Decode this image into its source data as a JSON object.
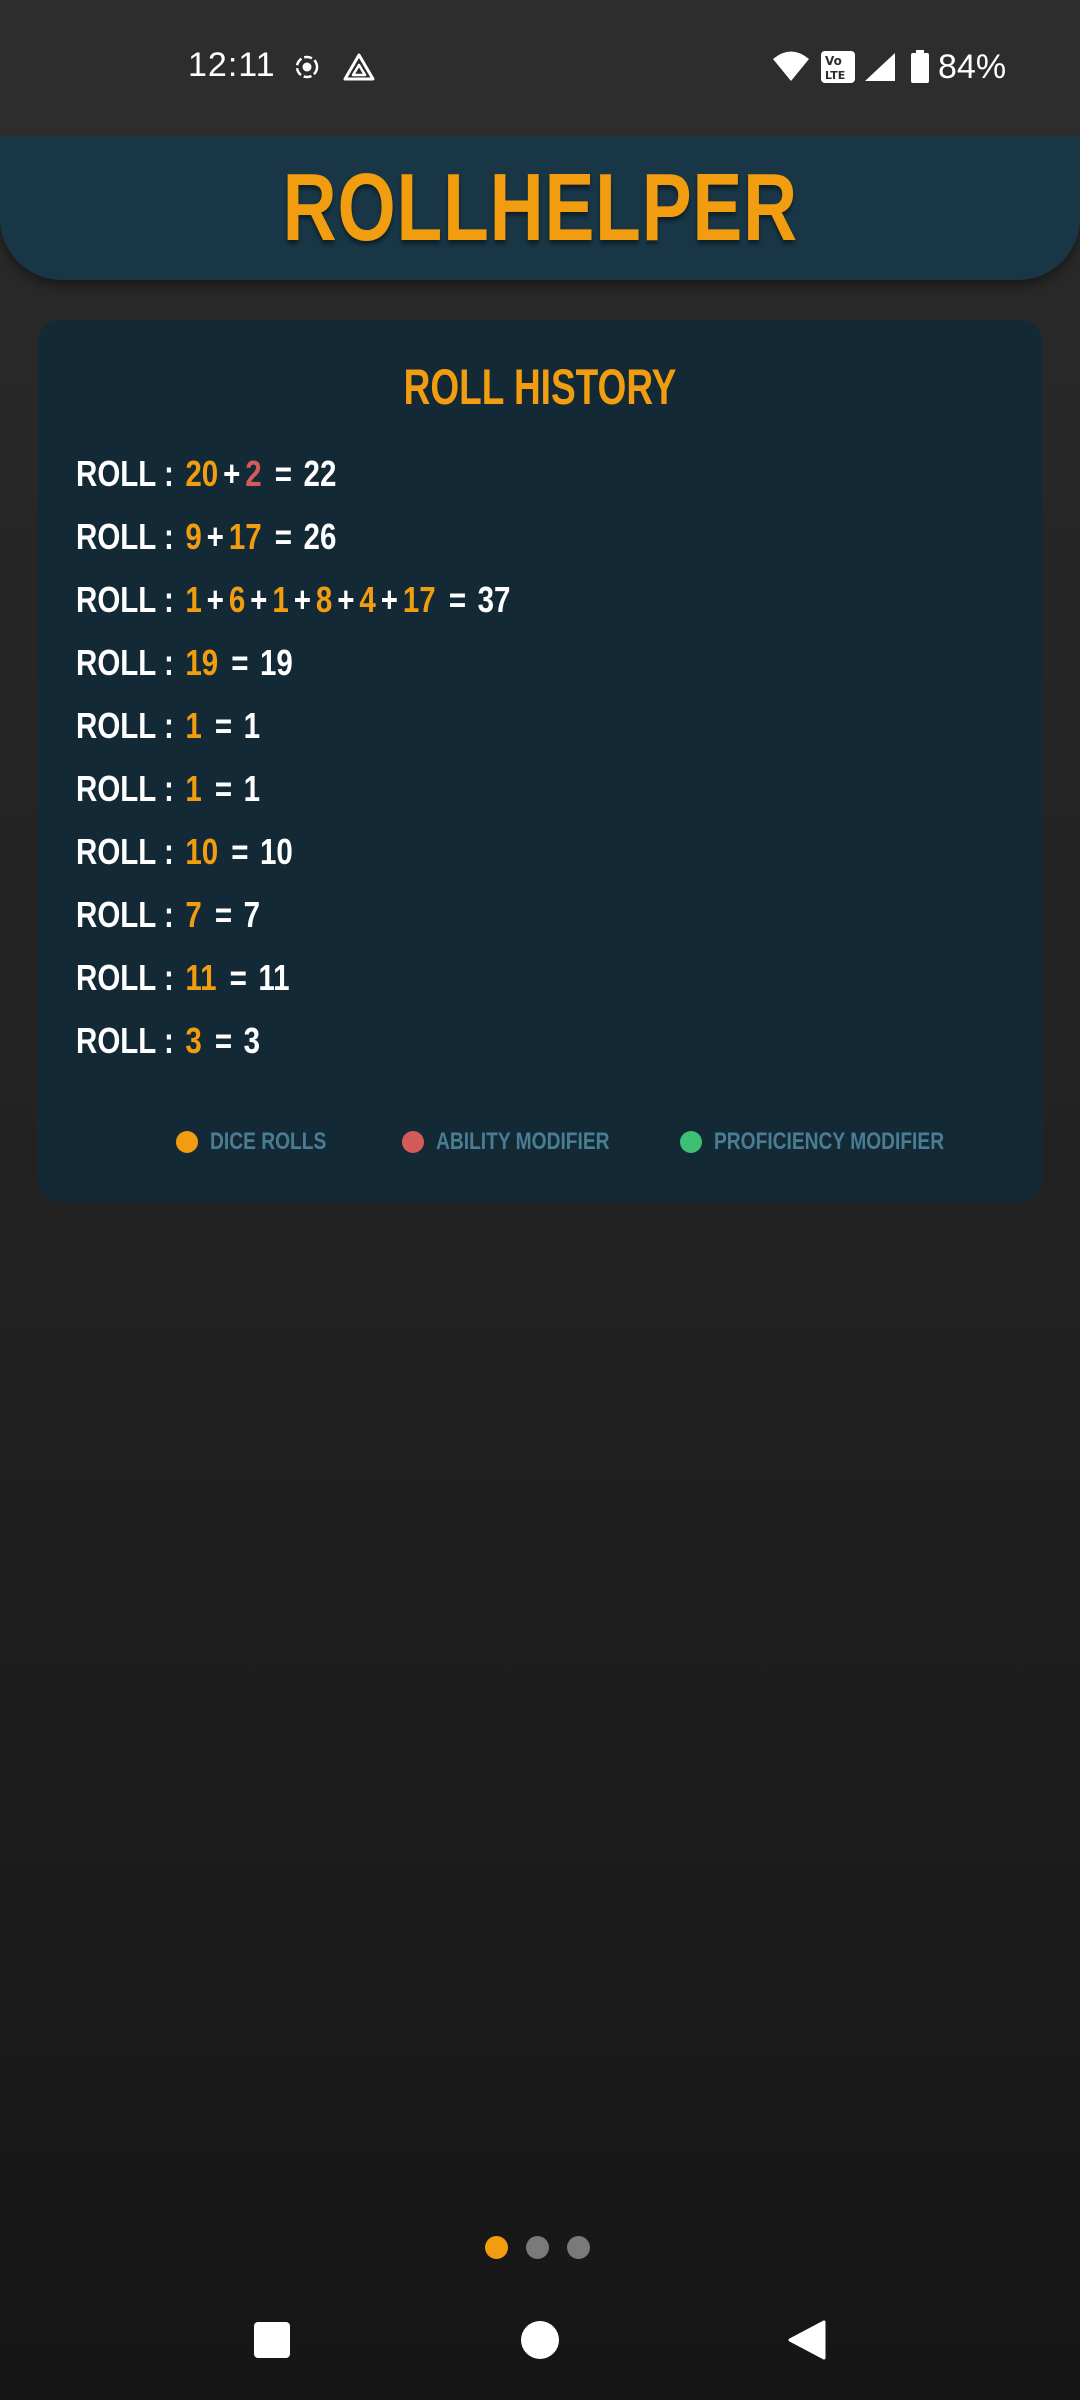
{
  "status_bar": {
    "time": "12:11",
    "battery": "84%",
    "icons": [
      "record-icon",
      "drive-icon",
      "wifi-icon",
      "volte-icon",
      "signal-icon",
      "battery-icon"
    ]
  },
  "header": {
    "title": "ROLLHELPER"
  },
  "roll_history": {
    "title": "ROLL HISTORY",
    "row_label": "ROLL :",
    "rows": [
      {
        "terms": [
          {
            "v": "20",
            "t": "dice"
          },
          {
            "v": "2",
            "t": "ability"
          }
        ],
        "total": "22"
      },
      {
        "terms": [
          {
            "v": "9",
            "t": "dice"
          },
          {
            "v": "17",
            "t": "dice"
          }
        ],
        "total": "26"
      },
      {
        "terms": [
          {
            "v": "1",
            "t": "dice"
          },
          {
            "v": "6",
            "t": "dice"
          },
          {
            "v": "1",
            "t": "dice"
          },
          {
            "v": "8",
            "t": "dice"
          },
          {
            "v": "4",
            "t": "dice"
          },
          {
            "v": "17",
            "t": "dice"
          }
        ],
        "total": "37"
      },
      {
        "terms": [
          {
            "v": "19",
            "t": "dice"
          }
        ],
        "total": "19"
      },
      {
        "terms": [
          {
            "v": "1",
            "t": "dice"
          }
        ],
        "total": "1"
      },
      {
        "terms": [
          {
            "v": "1",
            "t": "dice"
          }
        ],
        "total": "1"
      },
      {
        "terms": [
          {
            "v": "10",
            "t": "dice"
          }
        ],
        "total": "10"
      },
      {
        "terms": [
          {
            "v": "7",
            "t": "dice"
          }
        ],
        "total": "7"
      },
      {
        "terms": [
          {
            "v": "11",
            "t": "dice"
          }
        ],
        "total": "11"
      },
      {
        "terms": [
          {
            "v": "3",
            "t": "dice"
          }
        ],
        "total": "3"
      }
    ]
  },
  "legend": [
    {
      "label": "DICE ROLLS",
      "color": "#f29d0f"
    },
    {
      "label": "ABILITY MODIFIER",
      "color": "#d55b5b"
    },
    {
      "label": "PROFICIENCY MODIFIER",
      "color": "#3fbf73"
    }
  ],
  "pager": {
    "count": 3,
    "active": 0,
    "active_color": "#f29d0f",
    "inactive_color": "#7a7a7a"
  },
  "nav": {
    "buttons": [
      "recents-button",
      "home-button",
      "back-button"
    ]
  },
  "colors": {
    "accent": "#f29d0f",
    "header_bg": "#183645",
    "card_bg": "#132a36",
    "ability": "#d55b5b",
    "proficiency": "#3fbf73"
  }
}
